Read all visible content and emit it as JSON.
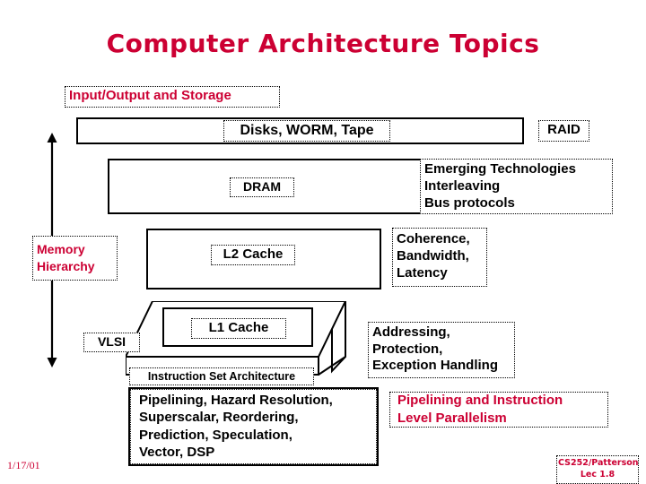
{
  "slide": {
    "title": "Computer Architecture Topics",
    "accent_color": "#CC0033",
    "text_color": "#000000",
    "background": "#FFFFFF"
  },
  "sections": {
    "io_storage_label": "Input/Output and Storage",
    "memory_hierarchy_label": "Memory\nHierarchy",
    "vlsi_label": "VLSI",
    "ilp_label": "Pipelining and Instruction\nLevel Parallelism"
  },
  "layers": [
    {
      "id": "storage",
      "inner_label": "Disks, WORM, Tape",
      "side_label": "RAID"
    },
    {
      "id": "dram",
      "inner_label": "DRAM",
      "side_label": "Emerging Technologies\nInterleaving\nBus protocols"
    },
    {
      "id": "l2",
      "inner_label": "L2 Cache",
      "side_label": "Coherence,\nBandwidth,\nLatency"
    },
    {
      "id": "l1",
      "inner_label": "L1 Cache",
      "front_label": "Instruction Set Architecture",
      "side_label": "Addressing,\nProtection,\nException Handling"
    },
    {
      "id": "pipeline",
      "inner_label": "Pipelining, Hazard Resolution,\nSuperscalar, Reordering,\nPrediction, Speculation,\nVector, DSP",
      "side_label": "Pipelining and Instruction\nLevel Parallelism"
    }
  ],
  "arrow": {
    "name": "memory-hierarchy-double-arrow",
    "direction": "vertical-double-headed"
  },
  "footer": {
    "date": "1/17/01",
    "credit": "CS252/Patterson\nLec 1.8"
  }
}
